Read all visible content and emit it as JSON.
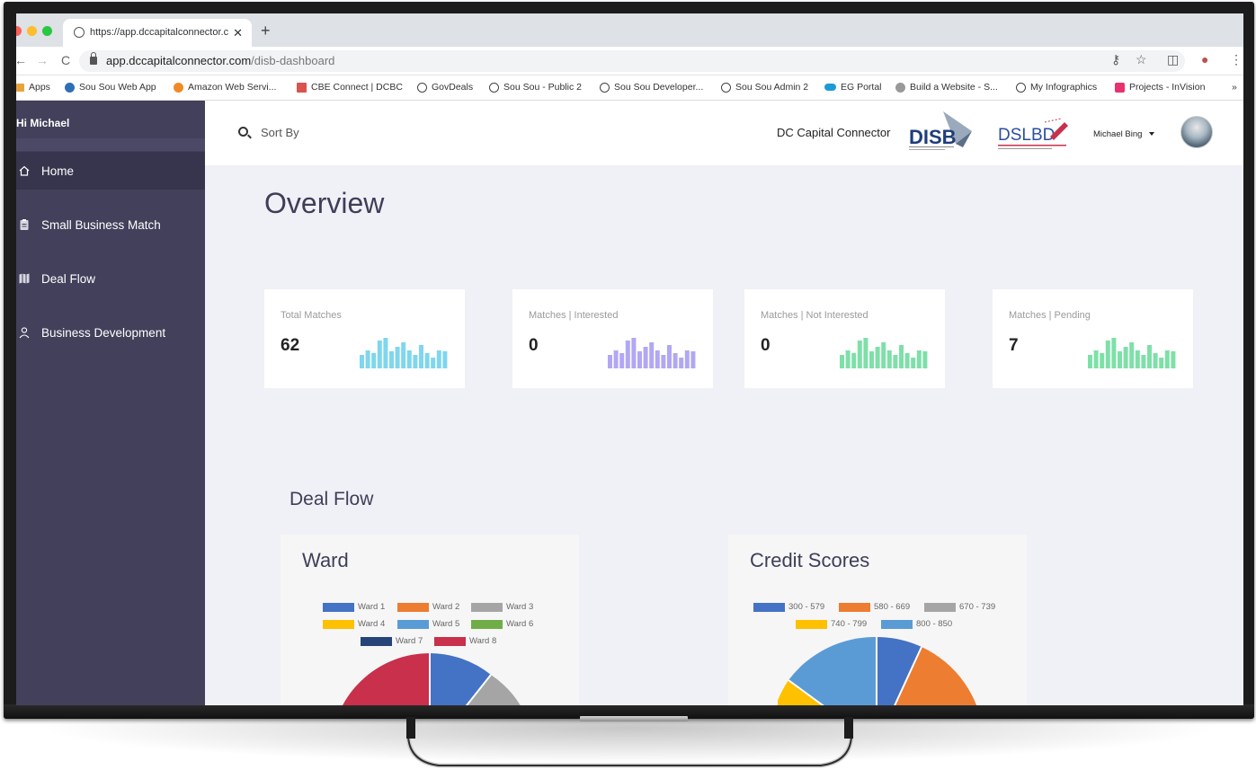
{
  "browser": {
    "tab_title": "https://app.dccapitalconnector.c",
    "url_host": "app.dccapitalconnector.com",
    "url_path": "/disb-dashboard",
    "bookmarks": [
      "Apps",
      "Sou Sou Web App",
      "Amazon Web Servi...",
      "CBE Connect | DCBC",
      "GovDeals",
      "Sou Sou - Public 2",
      "Sou Sou Developer...",
      "Sou Sou Admin 2",
      "EG Portal",
      "Build a Website - S...",
      "My Infographics",
      "Projects - InVision"
    ],
    "bookmark_overflow": "»"
  },
  "sidebar": {
    "greeting": "Hi Michael",
    "items": [
      {
        "label": "Home",
        "icon": "home-icon"
      },
      {
        "label": "Small Business Match",
        "icon": "clipboard-icon"
      },
      {
        "label": "Deal Flow",
        "icon": "map-icon"
      },
      {
        "label": "Business Development",
        "icon": "user-icon"
      }
    ]
  },
  "header": {
    "search_label": "Sort By",
    "brand": "DC Capital Connector",
    "logo1": "DISB",
    "logo2": "DSLBD",
    "user": "Michael Bing"
  },
  "main": {
    "title": "Overview",
    "cards": [
      {
        "label": "Total Matches",
        "value": "62",
        "color": "#7fd6ee"
      },
      {
        "label": "Matches | Interested",
        "value": "0",
        "color": "#b0a8f5"
      },
      {
        "label": "Matches | Not Interested",
        "value": "0",
        "color": "#7ee0a8"
      },
      {
        "label": "Matches | Pending",
        "value": "7",
        "color": "#7ee0a8"
      }
    ],
    "section_title": "Deal Flow"
  },
  "panels": [
    {
      "title": "Ward",
      "legend": [
        {
          "label": "Ward 1",
          "color": "#4472c4"
        },
        {
          "label": "Ward 2",
          "color": "#ed7d31"
        },
        {
          "label": "Ward 3",
          "color": "#a5a5a5"
        },
        {
          "label": "Ward 4",
          "color": "#ffc000"
        },
        {
          "label": "Ward 5",
          "color": "#5b9bd5"
        },
        {
          "label": "Ward 6",
          "color": "#70ad47"
        },
        {
          "label": "Ward 7",
          "color": "#264478"
        },
        {
          "label": "Ward 8",
          "color": "#c8304b"
        }
      ]
    },
    {
      "title": "Credit Scores",
      "legend": [
        {
          "label": "300 - 579",
          "color": "#4472c4"
        },
        {
          "label": "580 - 669",
          "color": "#ed7d31"
        },
        {
          "label": "670 - 739",
          "color": "#a5a5a5"
        },
        {
          "label": "740 - 799",
          "color": "#ffc000"
        },
        {
          "label": "800 - 850",
          "color": "#5b9bd5"
        }
      ]
    }
  ]
}
